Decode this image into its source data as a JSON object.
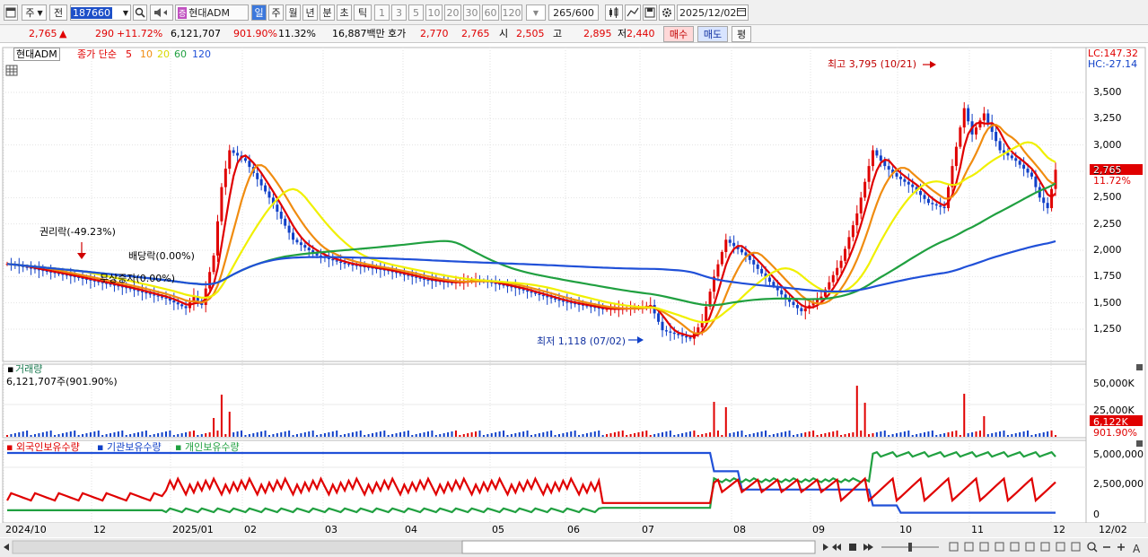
{
  "toolbar": {
    "market": "주",
    "mode": "전",
    "code": "187660",
    "name": "현대ADM",
    "periods": [
      "일",
      "주",
      "월",
      "년",
      "분",
      "초",
      "틱"
    ],
    "intervals": [
      "1",
      "3",
      "5",
      "10",
      "20",
      "30",
      "60",
      "120"
    ],
    "count": "265",
    "total": "/600",
    "date": "2025/12/02"
  },
  "quote": {
    "price": "2,765",
    "arrow": "▲",
    "change": "290",
    "change_pct": "+11.72%",
    "volume": "6,121,707",
    "volume_pct": "901.90%",
    "turnover": "11.32%",
    "amount": "16,887백만",
    "hoga_label": "호가",
    "hoga_ask": "2,770",
    "hoga_bid": "2,765",
    "open_label": "시",
    "open": "2,505",
    "high_label": "고",
    "high": "2,895",
    "low_label": "저",
    "low": "2,440",
    "buy": "매수",
    "sell": "매도",
    "avg": "평"
  },
  "price_panel": {
    "stock_name": "현대ADM",
    "ma_title": "종가 단순",
    "ma_periods": [
      "5",
      "10",
      "20",
      "60",
      "120"
    ],
    "lc": "LC:147.32",
    "hc": "HC:-27.14",
    "y_ticks": [
      "3,500",
      "3,250",
      "3,000",
      "2,750",
      "2,500",
      "2,250",
      "2,000",
      "1,750",
      "1,500",
      "1,250"
    ],
    "last_price": "2,765",
    "last_pct": "11.72%",
    "high_note": "최고 3,795 (10/21)",
    "low_note": "최저 1,118 (07/02)",
    "ann1": "권리락(-49.23%)",
    "ann2": "배당락(0.00%)",
    "ann3": "무상증자(0.00%)"
  },
  "volume_panel": {
    "title": "거래량",
    "info": "6,121,707주(901.90%)",
    "y_ticks": [
      "50,000K",
      "25,000K"
    ],
    "last": "6,122K",
    "last_pct": "901.90%"
  },
  "holdings_panel": {
    "legend": [
      "외국인보유수량",
      "기관보유수량",
      "개인보유수량"
    ],
    "y_ticks": [
      "5,000,000",
      "2,500,000",
      "0"
    ]
  },
  "x_axis": {
    "labels": [
      "2024/10",
      "12",
      "2025/01",
      "02",
      "03",
      "04",
      "05",
      "06",
      "07",
      "08",
      "09",
      "10",
      "11",
      "12",
      "12/02"
    ]
  },
  "colors": {
    "up": "#e00000",
    "down": "#1040c8",
    "ma5": "#e00000",
    "ma10": "#f08c10",
    "ma20": "#f0f000",
    "ma60": "#20a040",
    "ma120": "#2050d8"
  }
}
